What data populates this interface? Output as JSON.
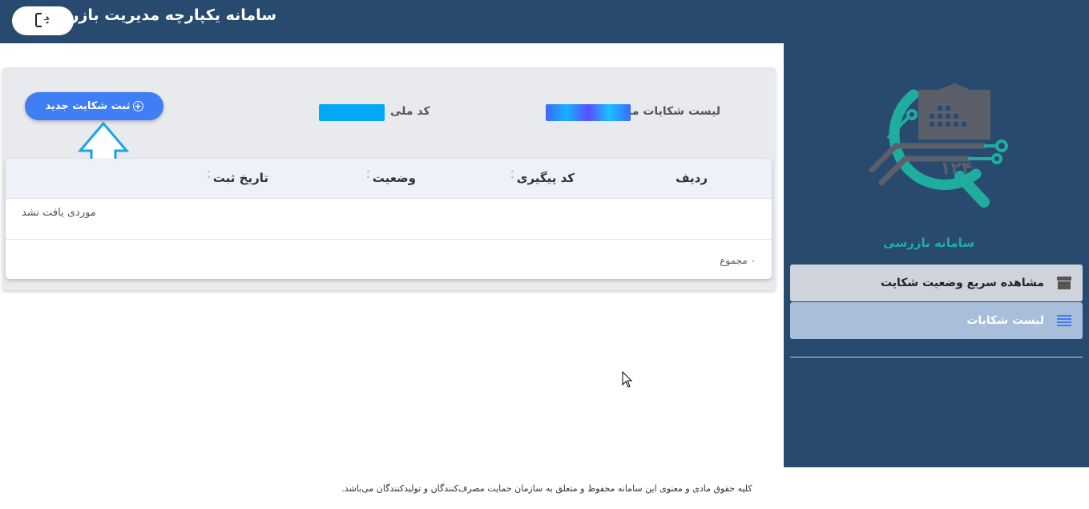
{
  "header": {
    "app_title": "سامانه یکپارچه مدیریت بازرسی",
    "logout_icon": "logout-icon"
  },
  "sidebar": {
    "logo_text": "سامانه بازرسی",
    "items": [
      {
        "label": "مشاهده سریع وضعیت شکایت",
        "icon": "archive-box-icon"
      },
      {
        "label": "لیست شکایات",
        "icon": "list-icon"
      }
    ]
  },
  "main": {
    "my_complaints_label": "لیست شکایات من",
    "national_code_label": "کد ملی",
    "new_complaint_button": "ثبت شکایت جدید",
    "table": {
      "columns": [
        "ردیف",
        "کد پیگیری",
        "وضعیت",
        "تاریخ ثبت"
      ],
      "empty_text": "موردی یافت نشد",
      "total_text": "۰ مجموع"
    }
  },
  "footer": {
    "text": "کلیه حقوق مادی و معنوی این سامانه محفوظ و متعلق به سازمان حمایت مصرف‌کنندگان و تولیدکنندگان می‌باشد."
  },
  "colors": {
    "header_bg": "#284a6f",
    "sidebar_bg": "#284a6f",
    "accent_button": "#3f7ef4",
    "logo_teal": "#1fae9e",
    "logo_gray": "#5b5f6a"
  }
}
